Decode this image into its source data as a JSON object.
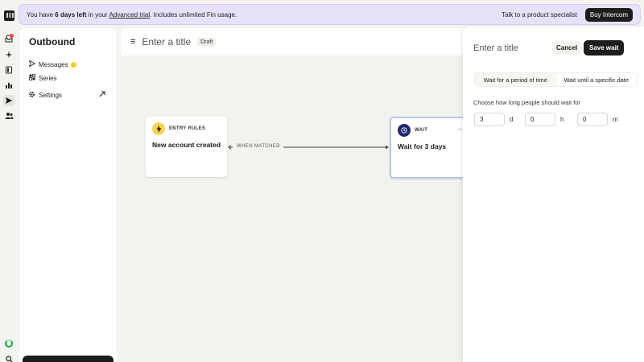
{
  "banner": {
    "text_before": "You have ",
    "days_left": "6 days left",
    "text_middle": " in your ",
    "trial_link": "Advanced trial",
    "text_after": ". Includes unlimited Fin usage.",
    "specialist_link": "Talk to a product specialist",
    "buy_button": "Buy Intercom"
  },
  "rail": {
    "icons": [
      "logo-icon",
      "inbox-icon",
      "ai-icon",
      "knowledge-icon",
      "reports-icon",
      "outbound-icon",
      "contacts-icon"
    ],
    "notification_count": "1"
  },
  "sidebar": {
    "title": "Outbound",
    "items": [
      {
        "label": "Messages",
        "icon": "send-icon",
        "badge": "!"
      },
      {
        "label": "Series",
        "icon": "series-icon"
      },
      {
        "label": "Settings",
        "icon": "gear-icon"
      }
    ]
  },
  "header": {
    "title_placeholder": "Enter a title",
    "status": "Draft"
  },
  "canvas": {
    "entry_node": {
      "type": "ENTRY RULES",
      "name": "New account created"
    },
    "connector_label": "WHEN MATCHED",
    "wait_node": {
      "type": "WAIT",
      "name": "Wait for 3 days",
      "more": "···"
    }
  },
  "panel": {
    "title_placeholder": "Enter a title",
    "cancel": "Cancel",
    "save": "Save wait",
    "tabs": [
      "Wait for a period of time",
      "Wait until a specific date"
    ],
    "prompt": "Choose how long people should wait for",
    "days_value": "3",
    "days_unit": "d",
    "hours_value": "0",
    "hours_unit": "h",
    "minutes_value": "0",
    "minutes_unit": "m"
  },
  "colors": {
    "banner_bg": "#e8e1fb",
    "accent_dark": "#1d1d1d",
    "bolt_yellow": "#f6d45a",
    "wait_navy": "#1e2a6e",
    "status_green": "#17a34a"
  }
}
